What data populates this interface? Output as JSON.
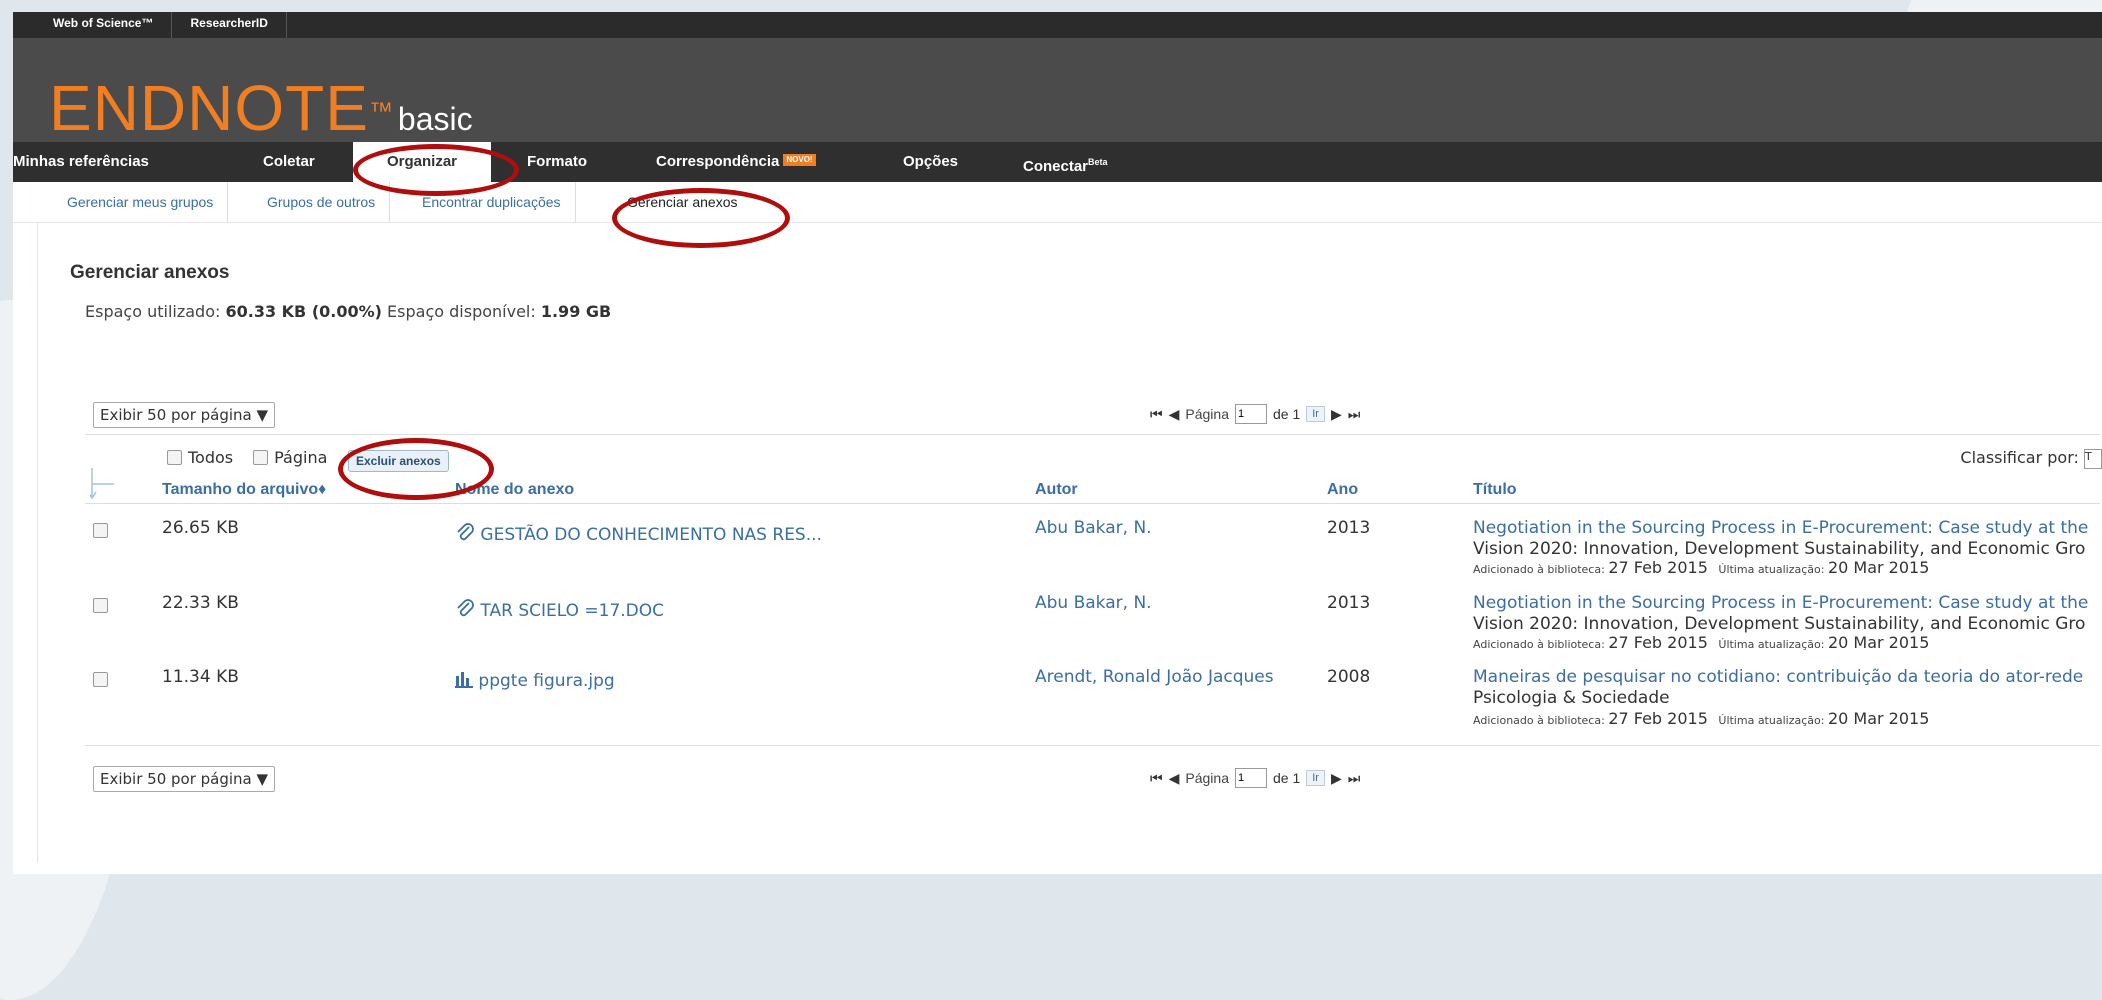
{
  "topbar": {
    "links": [
      "Web of Science™",
      "ResearcherID"
    ]
  },
  "brand": {
    "name": "ENDNOTE",
    "tm": "™",
    "edition": "basic"
  },
  "nav": {
    "items": [
      {
        "label": "Minhas referências"
      },
      {
        "label": "Coletar"
      },
      {
        "label": "Organizar"
      },
      {
        "label": "Formato"
      },
      {
        "label": "Correspondência",
        "badge": "NOVO!"
      },
      {
        "label": "Opções"
      },
      {
        "label": "Conectar",
        "sup": "Beta"
      }
    ]
  },
  "subnav": {
    "items": [
      "Gerenciar meus grupos",
      "Grupos de outros",
      "Encontrar duplicações",
      "Gerenciar anexos"
    ]
  },
  "page": {
    "title": "Gerenciar anexos",
    "used_label": "Espaço utilizado:",
    "used_value": "60.33 KB (0.00%)",
    "avail_label": "Espaço disponível:",
    "avail_value": "1.99 GB"
  },
  "pager": {
    "per_page": "Exibir 50 por página ▼",
    "page_label": "Página",
    "page_value": "1",
    "of": "de 1",
    "go": "Ir"
  },
  "controls": {
    "all": "Todos",
    "page": "Página",
    "delete": "Excluir anexos",
    "sort_by": "Classificar por:",
    "sort_value": "T"
  },
  "columns": {
    "size": "Tamanho do arquivo",
    "name": "Nome do anexo",
    "author": "Autor",
    "year": "Ano",
    "title": "Título"
  },
  "rows": [
    {
      "size": "26.65 KB",
      "name": "GESTÃO DO CONHECIMENTO NAS RES...",
      "icon": "paperclip-icon",
      "author": "Abu Bakar, N.",
      "year": "2013",
      "title": "Negotiation in the Sourcing Process in E-Procurement: Case study at the",
      "source": "Vision 2020: Innovation, Development Sustainability, and Economic Gro",
      "added_label": "Adicionado à biblioteca:",
      "added": "27 Feb 2015",
      "updated_label": "Última atualização:",
      "updated": "20 Mar 2015"
    },
    {
      "size": "22.33 KB",
      "name": "TAR SCIELO =17.DOC",
      "icon": "paperclip-icon",
      "author": "Abu Bakar, N.",
      "year": "2013",
      "title": "Negotiation in the Sourcing Process in E-Procurement: Case study at the",
      "source": "Vision 2020: Innovation, Development Sustainability, and Economic Gro",
      "added_label": "Adicionado à biblioteca:",
      "added": "27 Feb 2015",
      "updated_label": "Última atualização:",
      "updated": "20 Mar 2015"
    },
    {
      "size": "11.34 KB",
      "name": "ppgte figura.jpg",
      "icon": "image-chart-icon",
      "author": "Arendt, Ronald João Jacques",
      "year": "2008",
      "title": "Maneiras de pesquisar no cotidiano: contribuição da teoria do ator-rede",
      "source": "Psicologia & Sociedade",
      "added_label": "Adicionado à biblioteca:",
      "added": "27 Feb 2015",
      "updated_label": "Última atualização:",
      "updated": "20 Mar 2015"
    }
  ],
  "colors": {
    "brand_orange": "#f07e22",
    "link_blue": "#3a6ea5",
    "annotation_red": "#b00d0d"
  }
}
